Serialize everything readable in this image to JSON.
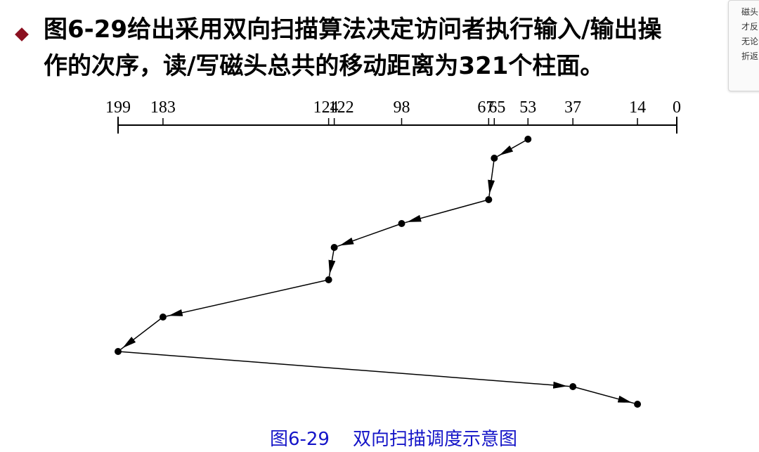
{
  "heading": {
    "line1": "图6-29给出采用双向扫描算法决定访问者执行输入/输出操",
    "line2": "作的次序，读/写磁头总共的移动距离为321个柱面。"
  },
  "side_note": {
    "lines": [
      "磁头",
      "才反",
      "无论",
      "折返"
    ]
  },
  "axis": {
    "ticks": [
      "199",
      "183",
      "124",
      "122",
      "98",
      "67",
      "65",
      "53",
      "37",
      "14",
      "0"
    ]
  },
  "chart_data": {
    "type": "line",
    "x_axis": {
      "direction": "decreasing-left-to-right",
      "range": [
        0,
        199
      ],
      "tick_labels": [
        "199",
        "183",
        "124",
        "122",
        "98",
        "67",
        "65",
        "53",
        "37",
        "14",
        "0"
      ]
    },
    "visit_order": [
      53,
      65,
      67,
      98,
      122,
      124,
      183,
      199,
      37,
      14
    ]
  },
  "caption": "图6-29    双向扫描调度示意图",
  "colors": {
    "bullet": "#8b1020",
    "caption": "#1515c8",
    "lines": "#000000"
  }
}
